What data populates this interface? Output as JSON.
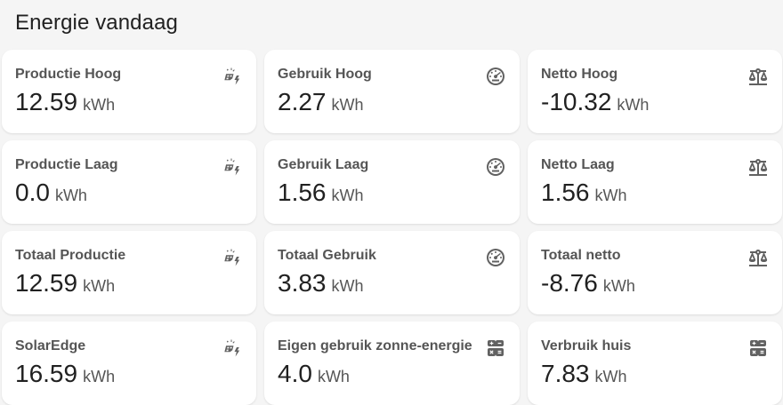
{
  "header": {
    "title": "Energie vandaag"
  },
  "cards": [
    {
      "name": "Productie Hoog",
      "value": "12.59",
      "unit": "kWh",
      "icon": "solar-power-icon"
    },
    {
      "name": "Gebruik Hoog",
      "value": "2.27",
      "unit": "kWh",
      "icon": "gauge-icon"
    },
    {
      "name": "Netto Hoog",
      "value": "-10.32",
      "unit": "kWh",
      "icon": "scale-balance-icon"
    },
    {
      "name": "Productie Laag",
      "value": "0.0",
      "unit": "kWh",
      "icon": "solar-power-icon"
    },
    {
      "name": "Gebruik Laag",
      "value": "1.56",
      "unit": "kWh",
      "icon": "gauge-icon"
    },
    {
      "name": "Netto Laag",
      "value": "1.56",
      "unit": "kWh",
      "icon": "scale-balance-icon"
    },
    {
      "name": "Totaal Productie",
      "value": "12.59",
      "unit": "kWh",
      "icon": "solar-power-icon"
    },
    {
      "name": "Totaal Gebruik",
      "value": "3.83",
      "unit": "kWh",
      "icon": "gauge-icon"
    },
    {
      "name": "Totaal netto",
      "value": "-8.76",
      "unit": "kWh",
      "icon": "scale-balance-icon"
    },
    {
      "name": "SolarEdge",
      "value": "16.59",
      "unit": "kWh",
      "icon": "solar-power-icon"
    },
    {
      "name": "Eigen gebruik zonne-energie",
      "value": "4.0",
      "unit": "kWh",
      "icon": "calculator-icon"
    },
    {
      "name": "Verbruik huis",
      "value": "7.83",
      "unit": "kWh",
      "icon": "calculator-icon"
    }
  ],
  "colors": {
    "background": "#f5f5f5",
    "card": "#ffffff",
    "icon": "#616161",
    "name": "#555555",
    "value": "#212121"
  }
}
